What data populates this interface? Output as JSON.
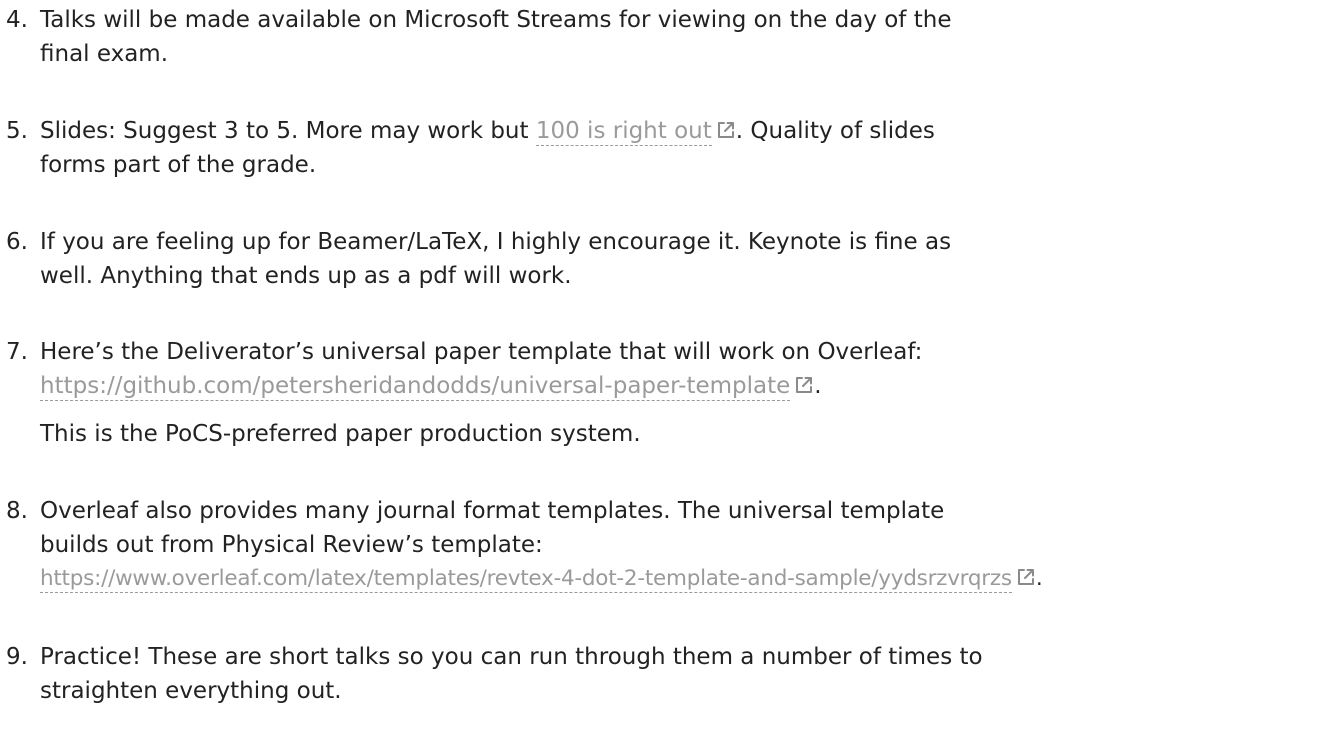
{
  "items": [
    {
      "number": "4.",
      "lines": [
        "Talks will be made available on Microsoft Streams for viewing on the day of the",
        "final exam."
      ]
    },
    {
      "number": "5.",
      "line1_before": "Slides: Suggest 3 to 5. More may work but ",
      "link_text": "100 is right out",
      "line1_after": ". Quality of slides",
      "line2": "forms part of the grade."
    },
    {
      "number": "6.",
      "lines": [
        "If you are feeling up for Beamer/LaTeX, I highly encourage it. Keynote is fine as",
        "well. Anything that ends up as a pdf will work."
      ]
    },
    {
      "number": "7.",
      "line1": "Here’s the Deliverator’s universal paper template that will work on Overleaf:",
      "link_text": "https://github.com/petersheridandodds/universal-paper-template",
      "after_link": ".",
      "paragraph2": "This is the PoCS-preferred paper production system."
    },
    {
      "number": "8.",
      "lines": [
        "Overleaf also provides many journal format templates. The universal template",
        "builds out from Physical Review’s template:"
      ],
      "link_text": "https://www.overleaf.com/latex/templates/revtex-4-dot-2-template-and-sample/yydsrzvrqrzs",
      "after_link": "."
    },
    {
      "number": "9.",
      "lines": [
        "Practice! These are short talks so you can run through them a number of times to",
        "straighten everything out."
      ]
    }
  ],
  "icons": {
    "external_link": "external-link-icon"
  },
  "colors": {
    "text": "#222222",
    "link": "#9a9a9a"
  }
}
